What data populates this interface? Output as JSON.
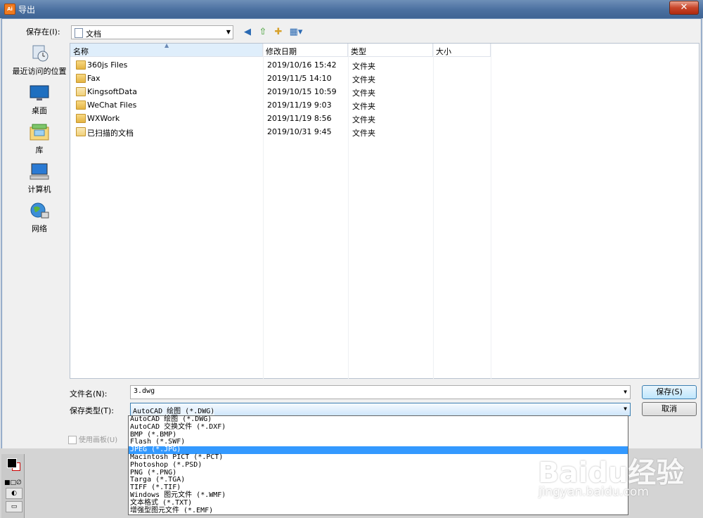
{
  "window": {
    "title": "导出",
    "app_icon_text": "Ai"
  },
  "toolbar": {
    "save_in_label": "保存在(I):",
    "save_in_value": "文档",
    "buttons": [
      "back-icon",
      "up-folder-icon",
      "new-folder-icon",
      "views-menu-icon"
    ]
  },
  "sidebar": {
    "items": [
      {
        "label": "最近访问的位置",
        "icon": "recent-places-icon"
      },
      {
        "label": "桌面",
        "icon": "desktop-icon"
      },
      {
        "label": "库",
        "icon": "libraries-icon"
      },
      {
        "label": "计算机",
        "icon": "computer-icon"
      },
      {
        "label": "网络",
        "icon": "network-icon"
      }
    ]
  },
  "file_list": {
    "columns": [
      "名称",
      "修改日期",
      "类型",
      "大小"
    ],
    "rows": [
      {
        "name": "360js Files",
        "date": "2019/10/16 15:42",
        "type": "文件夹",
        "size": ""
      },
      {
        "name": "Fax",
        "date": "2019/11/5 14:10",
        "type": "文件夹",
        "size": ""
      },
      {
        "name": "KingsoftData",
        "date": "2019/10/15 10:59",
        "type": "文件夹",
        "size": ""
      },
      {
        "name": "WeChat Files",
        "date": "2019/11/19 9:03",
        "type": "文件夹",
        "size": ""
      },
      {
        "name": "WXWork",
        "date": "2019/11/19 8:56",
        "type": "文件夹",
        "size": ""
      },
      {
        "name": "已扫描的文档",
        "date": "2019/10/31 9:45",
        "type": "文件夹",
        "size": ""
      }
    ]
  },
  "form": {
    "filename_label": "文件名(N):",
    "filename_value": "3.dwg",
    "filetype_label": "保存类型(T):",
    "filetype_value": "AutoCAD 绘图 (*.DWG)",
    "save_button": "保存(S)",
    "cancel_button": "取消",
    "use_artboards_label": "使用画板(U)"
  },
  "filetype_options": [
    "AutoCAD 绘图 (*.DWG)",
    "AutoCAD 交换文件 (*.DXF)",
    "BMP (*.BMP)",
    "Flash (*.SWF)",
    "JPEG (*.JPG)",
    "Macintosh PICT (*.PCT)",
    "Photoshop (*.PSD)",
    "PNG (*.PNG)",
    "Targa (*.TGA)",
    "TIFF (*.TIF)",
    "Windows 图元文件 (*.WMF)",
    "文本格式 (*.TXT)",
    "增强型图元文件 (*.EMF)"
  ],
  "highlighted_option_index": 4,
  "watermark": {
    "main": "Baidu经验",
    "sub": "jingyan.baidu.com"
  },
  "colors": {
    "title_bar": "#4a6f9f",
    "selection": "#3399ff",
    "close_button": "#c8452a"
  }
}
